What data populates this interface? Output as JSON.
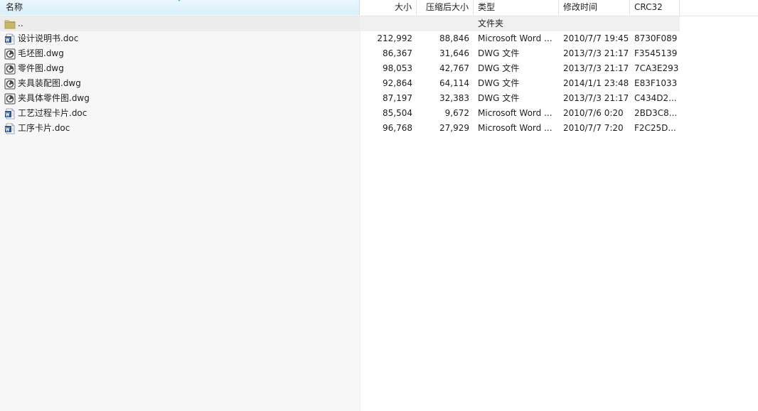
{
  "columns": {
    "name": "名称",
    "size": "大小",
    "packed": "压缩后大小",
    "type": "类型",
    "modified": "修改时间",
    "crc": "CRC32"
  },
  "parent_row": {
    "name": "..",
    "type": "文件夹",
    "icon": "folder-icon"
  },
  "files": [
    {
      "name": "设计说明书.doc",
      "size": "212,992",
      "packed": "88,846",
      "type": "Microsoft Word ...",
      "modified": "2010/7/7 19:45",
      "crc": "8730F089",
      "icon": "word-doc-icon"
    },
    {
      "name": "毛坯图.dwg",
      "size": "86,367",
      "packed": "31,646",
      "type": "DWG 文件",
      "modified": "2013/7/3 21:17",
      "crc": "F3545139",
      "icon": "dwg-file-icon"
    },
    {
      "name": "零件图.dwg",
      "size": "98,053",
      "packed": "42,767",
      "type": "DWG 文件",
      "modified": "2013/7/3 21:17",
      "crc": "7CA3E293",
      "icon": "dwg-file-icon"
    },
    {
      "name": "夹具装配图.dwg",
      "size": "92,864",
      "packed": "64,114",
      "type": "DWG 文件",
      "modified": "2014/1/1 23:48",
      "crc": "E83F1033",
      "icon": "dwg-file-icon"
    },
    {
      "name": "夹具体零件图.dwg",
      "size": "87,197",
      "packed": "32,383",
      "type": "DWG 文件",
      "modified": "2013/7/3 21:17",
      "crc": "C434D2...",
      "icon": "dwg-file-icon"
    },
    {
      "name": "工艺过程卡片.doc",
      "size": "85,504",
      "packed": "9,672",
      "type": "Microsoft Word ...",
      "modified": "2010/7/6 0:20",
      "crc": "2BD3C8...",
      "icon": "word-doc-icon"
    },
    {
      "name": "工序卡片.doc",
      "size": "96,768",
      "packed": "27,929",
      "type": "Microsoft Word ...",
      "modified": "2010/7/7 7:20",
      "crc": "F2C25D...",
      "icon": "word-doc-icon"
    }
  ],
  "colors": {
    "header_active": "#d9f0fc",
    "selection_bg": "#ececec",
    "name_column_bg": "#f7f7f7",
    "word_icon": "#2b579a",
    "dwg_icon": "#4a4a4a",
    "folder_icon": "#c8b866"
  }
}
